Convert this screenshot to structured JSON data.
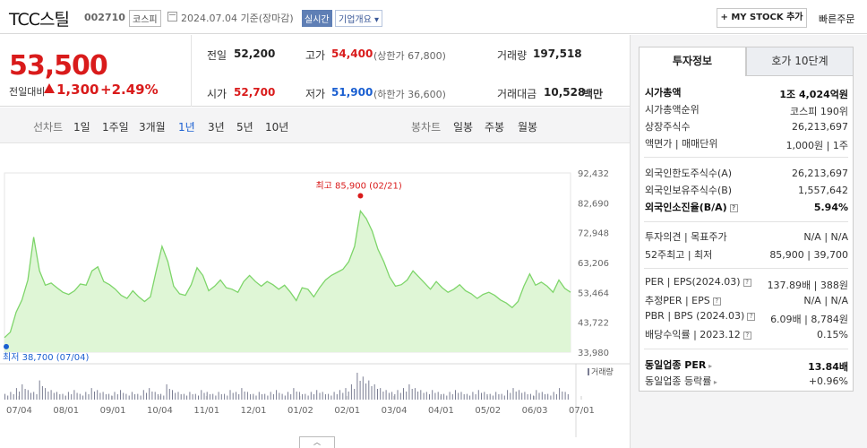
{
  "header": {
    "title": "TCC스틸",
    "code": "002710",
    "market": "코스피",
    "base_date": "2024.07.04  기준(장마감)",
    "realtime": "실시간",
    "corp_info": "기업개요 ▾",
    "mystock": "+ MY STOCK 추가",
    "quick_order": "빠른주문"
  },
  "price": {
    "current": "53,500",
    "change_label": "전일대비",
    "change_amount": "1,300",
    "change_pct": "+2.49%",
    "prev_close_label": "전일",
    "prev_close": "52,200",
    "open_label": "시가",
    "open": "52,700",
    "high_label": "고가",
    "high": "54,400",
    "upper_limit": "(상한가 67,800)",
    "low_label": "저가",
    "low": "51,900",
    "lower_limit": "(하한가 36,600)",
    "volume_label": "거래량",
    "volume": "197,518",
    "amount_label": "거래대금",
    "amount": "10,528",
    "amount_unit": "백만"
  },
  "period_nav": {
    "line_label": "선차트",
    "line_tabs": [
      "1일",
      "1주일",
      "3개월",
      "1년",
      "3년",
      "5년",
      "10년"
    ],
    "active_tab": "1년",
    "candle_label": "봉차트",
    "candle_tabs": [
      "일봉",
      "주봉",
      "월봉"
    ]
  },
  "chart_data": {
    "type": "area",
    "period": "1년",
    "y_ticks": [
      "92,432",
      "82,690",
      "72,948",
      "63,206",
      "53,464",
      "43,722",
      "33,980"
    ],
    "ylim": [
      33980,
      92432
    ],
    "x_labels": [
      "07/04",
      "08/01",
      "09/01",
      "10/04",
      "11/01",
      "12/01",
      "01/02",
      "02/01",
      "03/04",
      "04/01",
      "05/02",
      "06/03",
      "07/01"
    ],
    "high_annotation": "최고 85,900 (02/21)",
    "low_annotation": "최저 38,700 (07/04)",
    "volume_label": "거래량",
    "series": [
      {
        "values": [
          38700,
          40500,
          47000,
          51000,
          57500,
          71500,
          60500,
          55800,
          56500,
          55000,
          53500,
          52800,
          54000,
          56200,
          55800,
          60500,
          61800,
          57000,
          56000,
          54500,
          52500,
          51500,
          54000,
          52000,
          50500,
          52000,
          60500,
          68500,
          63500,
          55500,
          53000,
          52500,
          56000,
          61500,
          59000,
          54000,
          55500,
          57500,
          55000,
          54500,
          53500,
          57000,
          59000,
          57000,
          55500,
          57000,
          56000,
          54500,
          55800,
          53500,
          50800,
          55000,
          54500,
          52000,
          55000,
          57500,
          59000,
          60000,
          61000,
          63500,
          68500,
          80000,
          77500,
          73500,
          67500,
          63500,
          58500,
          55500,
          56000,
          57500,
          60500,
          58500,
          56500,
          54500,
          57000,
          55000,
          53500,
          54500,
          56000,
          54000,
          53000,
          51500,
          52800,
          53500,
          52500,
          51000,
          50000,
          48500,
          50500,
          55500,
          59500,
          55800,
          56800,
          55500,
          53500,
          57500,
          54800,
          53500
        ]
      }
    ],
    "volumes": [
      3,
      4,
      6,
      8,
      5,
      4,
      10,
      6,
      5,
      4,
      3,
      4,
      5,
      3,
      4,
      6,
      5,
      4,
      3,
      4,
      5,
      3,
      4,
      3,
      5,
      6,
      4,
      3,
      8,
      5,
      4,
      3,
      4,
      3,
      5,
      4,
      3,
      4,
      3,
      5,
      4,
      6,
      4,
      3,
      4,
      3,
      4,
      5,
      3,
      4,
      6,
      4,
      3,
      4,
      5,
      4,
      3,
      4,
      5,
      6,
      8,
      14,
      12,
      10,
      8,
      6,
      5,
      4,
      5,
      6,
      8,
      6,
      5,
      4,
      5,
      4,
      3,
      4,
      5,
      4,
      3,
      4,
      5,
      4,
      3,
      4,
      3,
      5,
      6,
      5,
      4,
      3,
      5,
      4,
      3,
      4,
      6,
      4
    ]
  },
  "right_panel": {
    "tabs": [
      "투자정보",
      "호가 10단계"
    ],
    "rows": [
      {
        "label": "시가총액",
        "value": "1조 4,024억원"
      },
      {
        "label": "시가총액순위",
        "value": "코스피 190위"
      },
      {
        "label": "상장주식수",
        "value": "26,213,697"
      },
      {
        "label": "액면가 | 매매단위",
        "value": "1,000원 | 1주"
      },
      {
        "label": "외국인한도주식수(A)",
        "value": "26,213,697"
      },
      {
        "label": "외국인보유주식수(B)",
        "value": "1,557,642"
      },
      {
        "label": "외국인소진율(B/A)",
        "value": "5.94%"
      },
      {
        "label": "투자의견 | 목표주가",
        "value": "N/A | N/A"
      },
      {
        "label": "52주최고 | 최저",
        "value": "85,900 | 39,700"
      },
      {
        "label": "PER | EPS(2024.03)",
        "value": "137.89배 | 388원"
      },
      {
        "label": "추정PER | EPS",
        "value": "N/A | N/A"
      },
      {
        "label": "PBR | BPS (2024.03)",
        "value": "6.09배 | 8,784원"
      },
      {
        "label": "배당수익률 | 2023.12",
        "value": "0.15%"
      },
      {
        "label": "동일업종 PER",
        "value": "13.84배"
      },
      {
        "label": "동일업종 등락률",
        "value": "+0.96%"
      }
    ]
  },
  "colors": {
    "up": "#d91b1b",
    "down": "#1a5fd1",
    "chart_line": "#7ed56a",
    "chart_fill": "#dff6d6"
  }
}
